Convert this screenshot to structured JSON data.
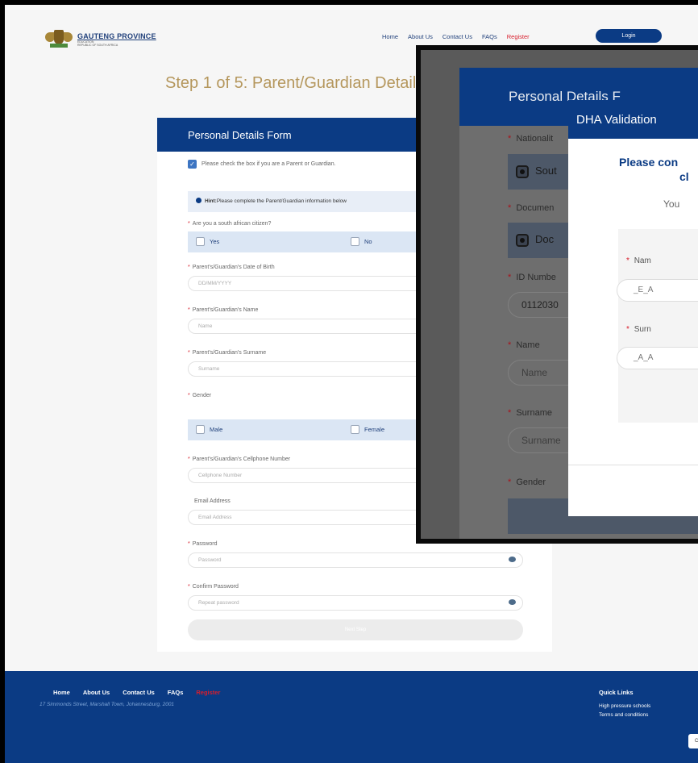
{
  "header": {
    "logo": {
      "title": "GAUTENG PROVINCE",
      "sub1": "EDUCATION",
      "sub2": "REPUBLIC OF SOUTH AFRICA"
    },
    "nav": [
      "Home",
      "About Us",
      "Contact Us",
      "FAQs"
    ],
    "register": "Register",
    "login": "Login"
  },
  "step_title": "Step 1 of 5: Parent/Guardian Details",
  "form": {
    "heading": "Personal Details Form",
    "parent_check": "Please check the box if you are a Parent or Guardian.",
    "hint_label": "Hint:",
    "hint_text": "Please complete the Parent/Guardian information below",
    "citizen_label": "Are you a south african citizen?",
    "citizen_yes": "Yes",
    "citizen_no": "No",
    "dob_label": "Parent's/Guardian's Date of Birth",
    "dob_placeholder": "DD/MM/YYYY",
    "name_label": "Parent's/Guardian's Name",
    "name_placeholder": "Name",
    "surname_label": "Parent's/Guardian's Surname",
    "surname_placeholder": "Surname",
    "gender_label": "Gender",
    "gender_male": "Male",
    "gender_female": "Female",
    "cell_label": "Parent's/Guardian's Cellphone Number",
    "cell_placeholder": "Cellphone Number",
    "email_label": "Email Address",
    "email_placeholder": "Email Address",
    "password_label": "Password",
    "password_placeholder": "Password",
    "confirm_label": "Confirm Password",
    "confirm_placeholder": "Repeat password",
    "submit": "Next Step",
    "required_mark": "*",
    "check_mark": "✓"
  },
  "footer": {
    "nav": [
      "Home",
      "About Us",
      "Contact Us",
      "FAQs"
    ],
    "register": "Register",
    "address": "17 Simmonds Street, Marshall Town, Johannesburg, 2001",
    "quick_links_title": "Quick Links",
    "quick_links": [
      "High pressure schools",
      "Terms and conditions"
    ],
    "button_fragment": "C"
  },
  "zoomed": {
    "heading": "Personal Details F",
    "nationality_label": "Nationalit",
    "nationality_option": "Sout",
    "document_label": "Documen",
    "document_option": "Doc",
    "id_label": "ID Numbe",
    "id_value": "0112030",
    "name_label": "Name",
    "name_placeholder": "Name",
    "surname_label": "Surname",
    "surname_placeholder": "Surname",
    "gender_label": "Gender"
  },
  "dha_modal": {
    "title": "DHA Validation",
    "question_line1": "Please con",
    "question_line2": "cl",
    "you_text": "You",
    "name_label": "Nam",
    "name_value": "_E_A",
    "surname_label": "Surn",
    "surname_value": "_A_A"
  }
}
